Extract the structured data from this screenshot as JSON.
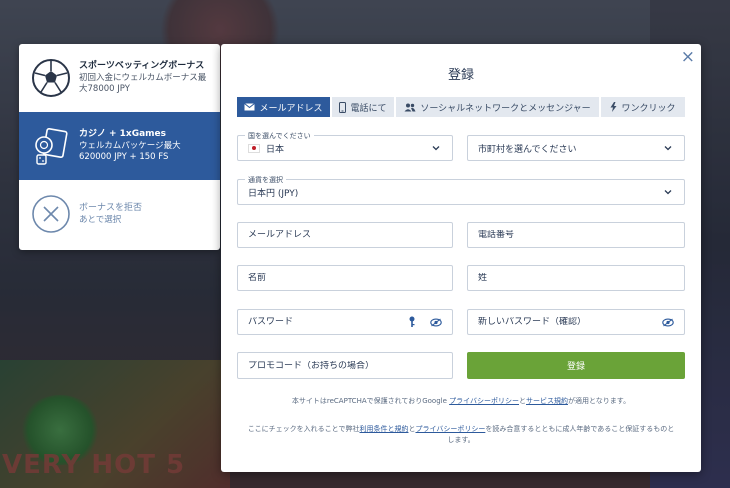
{
  "bonus_panel": {
    "items": [
      {
        "title": "スポーツベッティングボーナス",
        "desc": "初回入金にウェルカムボーナス最大78000 JPY",
        "icon": "soccer-ball-icon",
        "active": false
      },
      {
        "title": "カジノ + 1xGames",
        "desc": "ウェルカムパッケージ最大620000 JPY + 150 FS",
        "icon": "casino-chips-icon",
        "active": true
      },
      {
        "title": "ボーナスを拒否",
        "desc": "あとで選択",
        "icon": "reject-x-icon",
        "active": false
      }
    ]
  },
  "modal": {
    "title": "登録",
    "close_label": "×",
    "tabs": [
      {
        "label": "メールアドレス",
        "icon": "envelope-icon",
        "active": true
      },
      {
        "label": "電話にて",
        "icon": "phone-icon",
        "active": false
      },
      {
        "label": "ソーシャルネットワークとメッセンジャー",
        "icon": "users-icon",
        "active": false
      },
      {
        "label": "ワンクリック",
        "icon": "lightning-icon",
        "active": false
      }
    ],
    "country": {
      "label": "国を選んでください",
      "value": "日本"
    },
    "city": {
      "placeholder": "市町村を選んでください"
    },
    "currency": {
      "label": "通貨を選択",
      "value": "日本円 (JPY)"
    },
    "email": {
      "placeholder": "メールアドレス"
    },
    "phone": {
      "placeholder": "電話番号"
    },
    "first_name": {
      "placeholder": "名前"
    },
    "last_name": {
      "placeholder": "姓"
    },
    "password": {
      "placeholder": "パスワード"
    },
    "password_confirm": {
      "placeholder": "新しいパスワード（確認）"
    },
    "promo": {
      "placeholder": "プロモコード（お持ちの場合）"
    },
    "submit_label": "登録",
    "recaptcha": {
      "prefix": "本サイトはreCAPTCHAで保護されておりGoogle ",
      "privacy_link": "プライバシーポリシー",
      "and": "と",
      "terms_link": "サービス規約",
      "suffix": "が適用となります。"
    },
    "consent": {
      "prefix": "ここにチェックを入れることで弊社",
      "terms_link": "利用条件と規約",
      "and": "と",
      "privacy_link": "プライバシーポリシー",
      "suffix": "を読み合意するとともに成人年齢であること保証するものとします。"
    }
  },
  "background": {
    "game_title": "VERY HOT 5"
  },
  "colors": {
    "primary": "#2d5a9c",
    "submit": "#6aa338",
    "tab_inactive": "#e3e8ef"
  }
}
